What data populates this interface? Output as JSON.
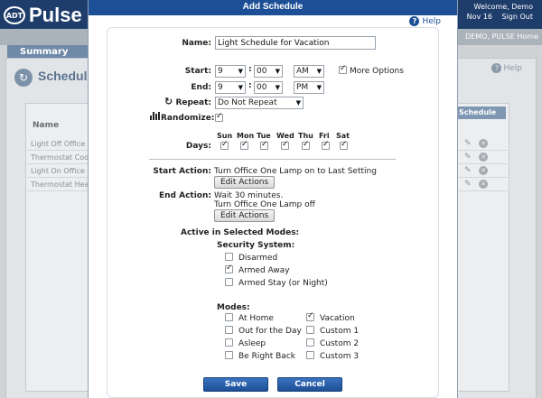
{
  "background": {
    "logo_badge": "ADT",
    "logo_text": "Pulse",
    "welcome": "Welcome, Demo",
    "date": "Nov 16",
    "sign_out": "Sign Out",
    "account": "DEMO, PULSE Home",
    "summary_tab": "Summary",
    "page_title": "Schedule",
    "help": "Help",
    "name_header": "Name",
    "list_header": "Schedule",
    "rows": [
      "Light Off Office",
      "Thermostat Coo",
      "Light On Office",
      "Thermostat Hea"
    ]
  },
  "modal": {
    "title": "Add Schedule",
    "help": "Help",
    "name_label": "Name:",
    "name_value": "Light Schedule for Vacation",
    "start_label": "Start:",
    "start_hour": "9",
    "start_minute": "00",
    "start_ampm": "AM",
    "more_options": "More Options",
    "end_label": "End:",
    "end_hour": "9",
    "end_minute": "00",
    "end_ampm": "PM",
    "repeat_label": "Repeat:",
    "repeat_value": "Do Not Repeat",
    "randomize_label": "Randomize:",
    "days_label": "Days:",
    "days": [
      "Sun",
      "Mon",
      "Tue",
      "Wed",
      "Thu",
      "Fri",
      "Sat"
    ],
    "start_action_label": "Start Action:",
    "start_action_text": "Turn Office One Lamp on to Last Setting",
    "edit_actions": "Edit Actions",
    "end_action_label": "End Action:",
    "end_action_line1": "Wait 30 minutes.",
    "end_action_line2": "Turn Office One Lamp off",
    "active_modes_label": "Active in Selected Modes:",
    "security_system_label": "Security System:",
    "security_options": [
      "Disarmed",
      "Armed Away",
      "Armed Stay (or Night)"
    ],
    "modes_label": "Modes:",
    "modes_left": [
      "At Home",
      "Out for the Day",
      "Asleep",
      "Be Right Back"
    ],
    "modes_right": [
      "Vacation",
      "Custom 1",
      "Custom 2",
      "Custom 3"
    ],
    "save": "Save",
    "cancel": "Cancel"
  }
}
